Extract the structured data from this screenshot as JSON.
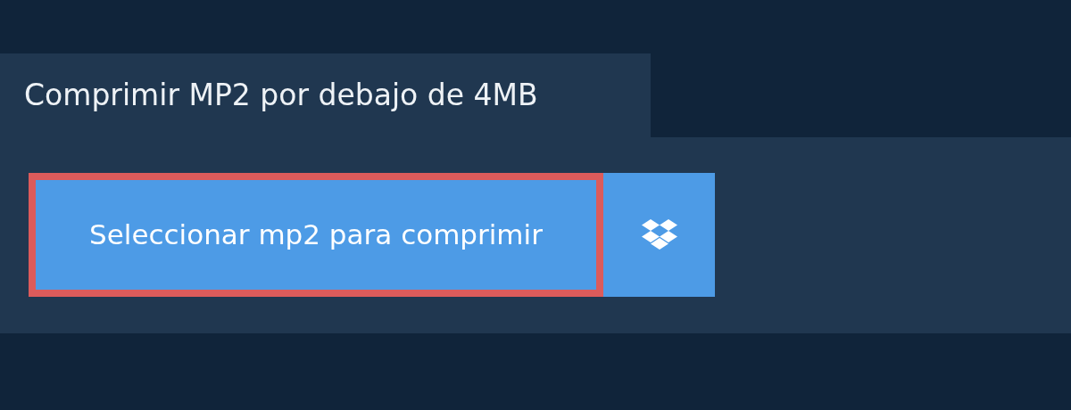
{
  "tab": {
    "title": "Comprimir MP2 por debajo de 4MB"
  },
  "select_button": {
    "label": "Seleccionar mp2 para comprimir",
    "focused": true
  },
  "cloud_button": {
    "kind": "boxes"
  }
}
